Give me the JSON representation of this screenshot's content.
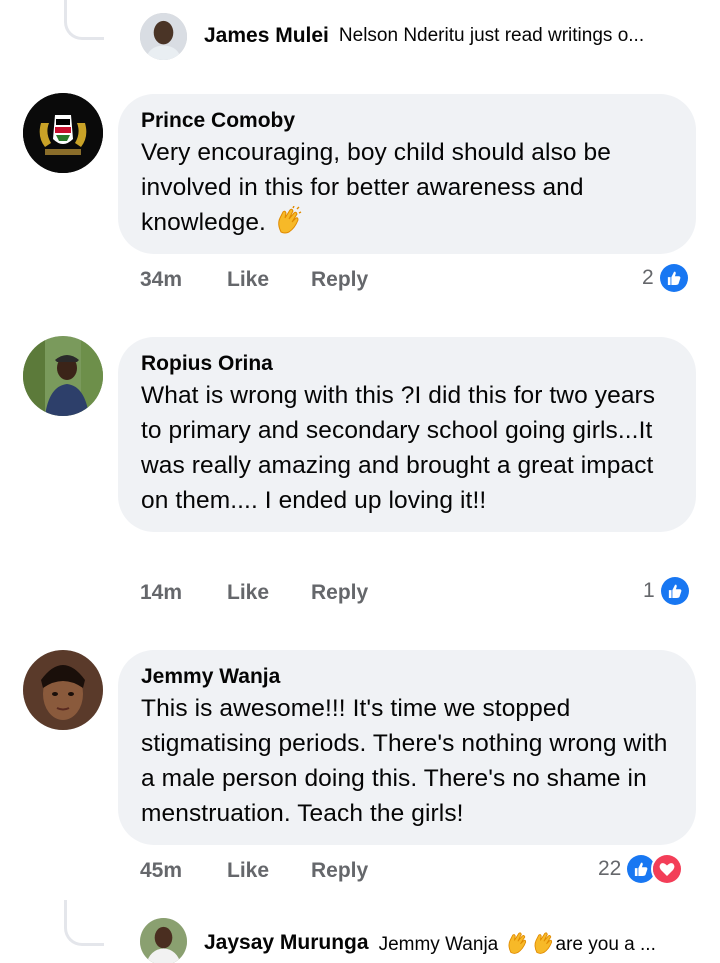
{
  "top_reply": {
    "name": "James Mulei",
    "preview": "Nelson Nderitu just read writings o..."
  },
  "comments": [
    {
      "author": "Prince Comoby",
      "text": "Very encouraging, boy child should also be involved in this for better awareness and knowledge.",
      "emoji": "clapping-hands",
      "time": "34m",
      "like_label": "Like",
      "reply_label": "Reply",
      "reaction_count": "2",
      "reactions": [
        "like"
      ]
    },
    {
      "author": "Ropius Orina",
      "text": "What is wrong with this ?I did this for two years to primary and secondary school going girls...It was really amazing and brought a great impact on them.... I ended up loving it!!",
      "time": "14m",
      "like_label": "Like",
      "reply_label": "Reply",
      "reaction_count": "1",
      "reactions": [
        "like"
      ]
    },
    {
      "author": "Jemmy Wanja",
      "text": "This is awesome!!! It's time we stopped stigmatising periods. There's nothing wrong with a male person doing this. There's no shame in menstruation. Teach the girls!",
      "time": "45m",
      "like_label": "Like",
      "reply_label": "Reply",
      "reaction_count": "22",
      "reactions": [
        "like",
        "love"
      ]
    }
  ],
  "bottom_reply": {
    "name": "Jaysay Murunga",
    "mention": "Jemmy Wanja",
    "emojis": [
      "clapping-hands",
      "clapping-hands"
    ],
    "preview": "are you a ..."
  },
  "colors": {
    "bubble": "#f0f2f5",
    "meta_text": "#65676b",
    "like_blue": "#1877f2",
    "love_red": "#f33e58"
  }
}
